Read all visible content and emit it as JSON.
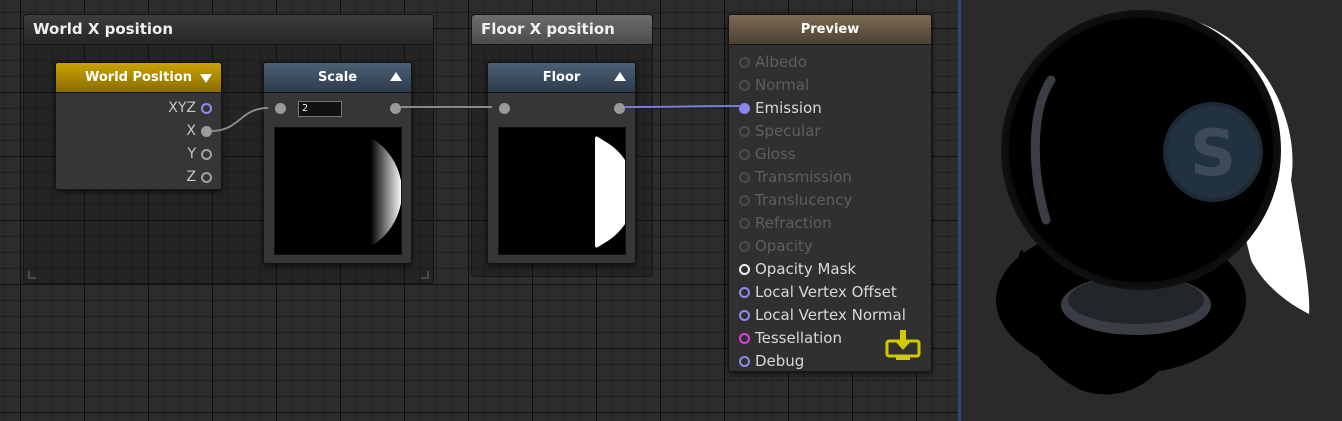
{
  "frames": {
    "world_x": {
      "title": "World X position"
    },
    "floor_x": {
      "title": "Floor X position"
    }
  },
  "nodes": {
    "world_position": {
      "title": "World Position",
      "outputs": [
        "XYZ",
        "X",
        "Y",
        "Z"
      ]
    },
    "scale": {
      "title": "Scale",
      "value": "2"
    },
    "floor": {
      "title": "Floor"
    },
    "preview": {
      "title": "Preview",
      "inputs": [
        {
          "label": "Albedo",
          "state": "dim"
        },
        {
          "label": "Normal",
          "state": "dim"
        },
        {
          "label": "Emission",
          "state": "connected"
        },
        {
          "label": "Specular",
          "state": "dim"
        },
        {
          "label": "Gloss",
          "state": "dim"
        },
        {
          "label": "Transmission",
          "state": "dim"
        },
        {
          "label": "Translucency",
          "state": "dim"
        },
        {
          "label": "Refraction",
          "state": "dim"
        },
        {
          "label": "Opacity",
          "state": "dim"
        },
        {
          "label": "Opacity Mask",
          "state": "white"
        },
        {
          "label": "Local Vertex Offset",
          "state": "blue"
        },
        {
          "label": "Local Vertex Normal",
          "state": "blue"
        },
        {
          "label": "Tessellation",
          "state": "magenta"
        },
        {
          "label": "Debug",
          "state": "blue"
        }
      ]
    }
  },
  "viewport": {
    "logo_letter": "S"
  },
  "colors": {
    "accent_gold": "#caa300",
    "wire_grey": "#8a8a8a",
    "wire_blue": "#7b79e0",
    "divider_blue": "#2d4a75",
    "save_icon": "#d4c800"
  },
  "icons": {
    "save": "save-to-disk-icon"
  }
}
